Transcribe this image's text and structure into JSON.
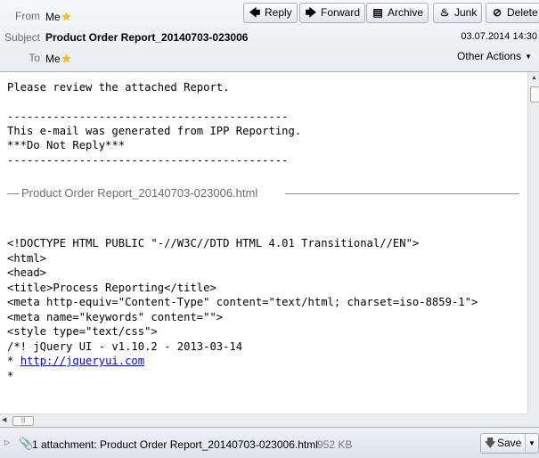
{
  "header": {
    "from_label": "From",
    "from_value": "Me",
    "subject_label": "Subject",
    "subject_value": "Product Order Report_20140703-023006",
    "to_label": "To",
    "to_value": "Me",
    "date": "03.07.2014 14:30",
    "other_actions": "Other Actions",
    "star_icon": "star-icon"
  },
  "toolbar": {
    "reply": "Reply",
    "forward": "Forward",
    "archive": "Archive",
    "junk": "Junk",
    "delete": "Delete"
  },
  "body": {
    "intro": "Please review the attached Report.",
    "rule1": "-------------------------------------------",
    "generated": "This e-mail was generated from IPP Reporting.",
    "no_reply": "***Do Not Reply***",
    "rule2": "-------------------------------------------",
    "attachment_name": "Product Order Report_20140703-023006.html",
    "code_lines": [
      "<!DOCTYPE HTML PUBLIC \"-//W3C//DTD HTML 4.01 Transitional//EN\">",
      "",
      "<html>",
      "<head>",
      "<title>Process Reporting</title>",
      "<meta http-equiv=\"Content-Type\" content=\"text/html; charset=iso-8859-1\">",
      "<meta name=\"keywords\" content=\"\">",
      "",
      "<style type=\"text/css\">",
      "/*! jQuery UI - v1.10.2 - 2013-03-14"
    ],
    "link_prefix": "* ",
    "link_text": "http://jqueryui.com",
    "last_line": "*"
  },
  "attachment_bar": {
    "text": "1 attachment: Product Order Report_20140703-023006.html",
    "size": "952 KB",
    "save": "Save"
  }
}
